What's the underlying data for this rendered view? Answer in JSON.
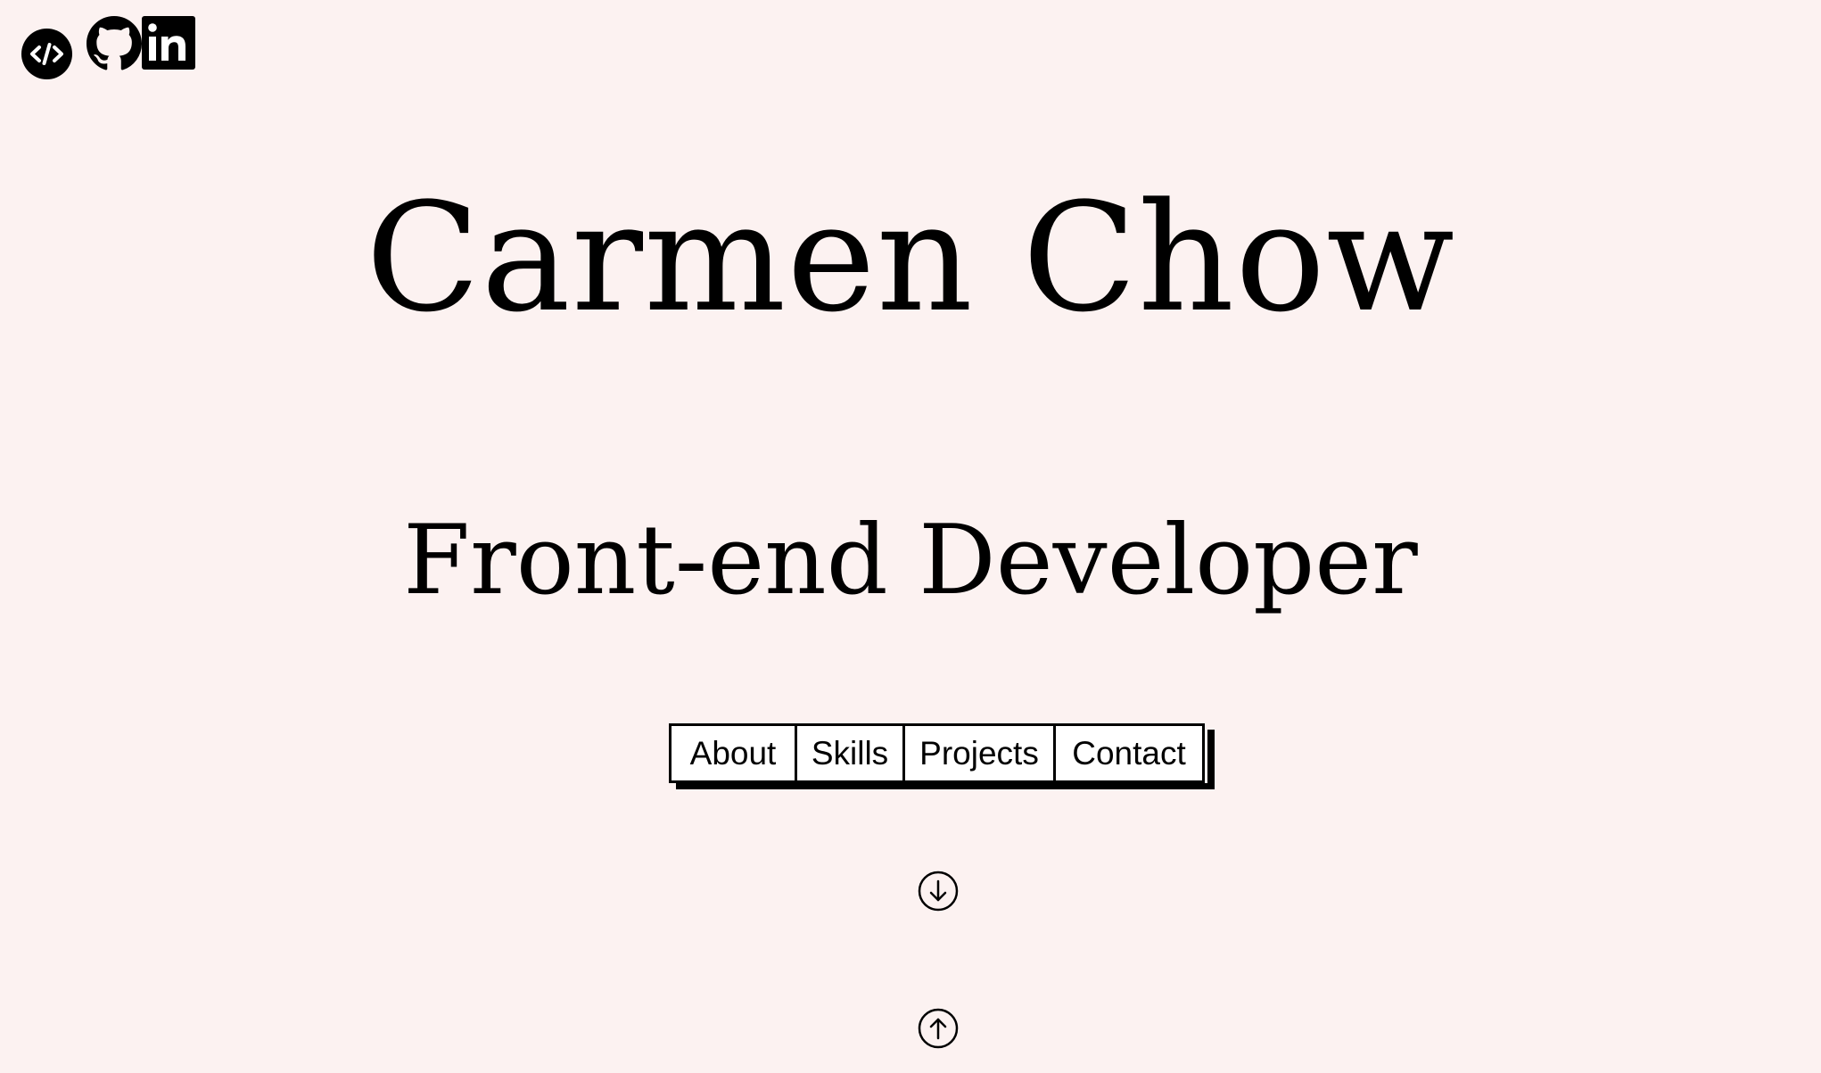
{
  "social": {
    "codepen_icon": "code-icon",
    "github_icon": "github-icon",
    "linkedin_icon": "linkedin-icon",
    "linkedin_text": "in"
  },
  "hero": {
    "name": "Carmen Chow",
    "role": "Front-end Developer"
  },
  "nav": {
    "items": [
      {
        "label": "About"
      },
      {
        "label": "Skills"
      },
      {
        "label": "Projects"
      },
      {
        "label": "Contact"
      }
    ]
  },
  "scroll": {
    "down_icon": "arrow-down-circle-icon",
    "up_icon": "arrow-up-circle-icon"
  },
  "colors": {
    "background": "#fcf2f1",
    "text": "#000000",
    "button_bg": "#ffffff"
  }
}
